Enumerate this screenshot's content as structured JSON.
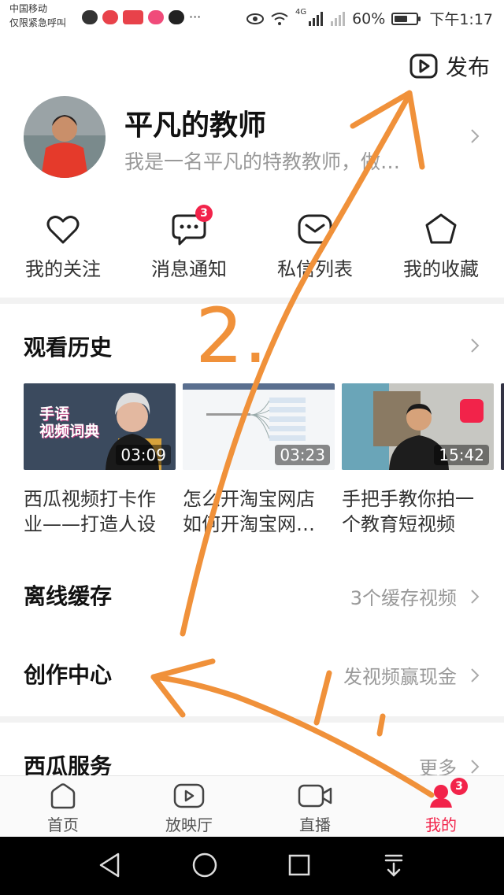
{
  "status_bar": {
    "carrier_line1": "中国移动",
    "carrier_line2": "仅限紧急呼叫",
    "signal_label": "4G",
    "battery_percent": "60%",
    "battery_level": 0.6,
    "time": "下午1:17"
  },
  "header": {
    "publish_label": "发布",
    "publish_icon": "play-square-icon"
  },
  "profile": {
    "name": "平凡的教师",
    "bio": "我是一名平凡的特教教师，做…"
  },
  "quick_actions": [
    {
      "label": "我的关注",
      "icon": "heart-icon"
    },
    {
      "label": "消息通知",
      "icon": "chat-bubble-icon",
      "badge": "3"
    },
    {
      "label": "私信列表",
      "icon": "envelope-icon"
    },
    {
      "label": "我的收藏",
      "icon": "star-icon"
    }
  ],
  "history": {
    "title": "观看历史",
    "videos": [
      {
        "duration": "03:09",
        "title": "西瓜视频打卡作\n业——打造人设",
        "thumb_caption": "手语\n视频词典"
      },
      {
        "duration": "03:23",
        "title": "怎么开淘宝网店\n如何开淘宝网…"
      },
      {
        "duration": "15:42",
        "title": "手把手教你拍一\n个教育短视频"
      }
    ]
  },
  "offline_cache": {
    "title": "离线缓存",
    "value": "3个缓存视频"
  },
  "creator_center": {
    "title": "创作中心",
    "value": "发视频赢现金"
  },
  "xigua_services": {
    "title": "西瓜服务",
    "value": "更多"
  },
  "tabs": [
    {
      "label": "首页",
      "icon": "home-icon"
    },
    {
      "label": "放映厅",
      "icon": "play-tv-icon"
    },
    {
      "label": "直播",
      "icon": "video-camera-icon"
    },
    {
      "label": "我的",
      "icon": "user-icon",
      "badge": "3",
      "active": true
    }
  ],
  "annotations": {
    "label": "2."
  },
  "colors": {
    "accent": "#f2234a",
    "annotation": "#f0913a"
  }
}
